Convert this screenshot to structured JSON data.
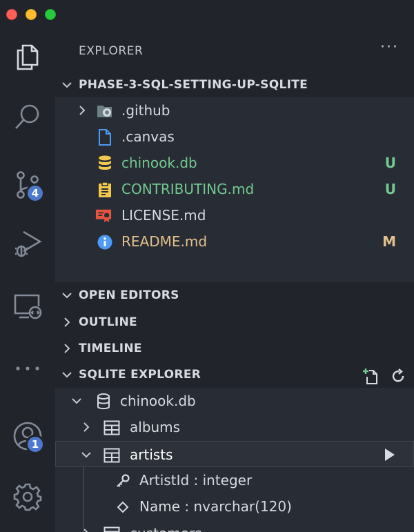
{
  "activity_bar": {
    "scm_badge": "4",
    "accounts_badge": "1",
    "items": [
      "files-icon",
      "search-icon",
      "source-control-icon",
      "run-debug-icon",
      "remote-explorer-icon",
      "more-icon",
      "accounts-icon",
      "gear-icon"
    ]
  },
  "explorer": {
    "title": "EXPLORER",
    "more": "···",
    "project_section": "PHASE-3-SQL-SETTING-UP-SQLITE",
    "files": [
      {
        "name": ".github",
        "icon": "github-folder-icon",
        "status": "",
        "color": "#d7dae0"
      },
      {
        "name": ".canvas",
        "icon": "file-icon",
        "status": "",
        "color": "#d7dae0"
      },
      {
        "name": "chinook.db",
        "icon": "database-icon",
        "status": "U",
        "color": "#73c991"
      },
      {
        "name": "CONTRIBUTING.md",
        "icon": "clipboard-icon",
        "status": "U",
        "color": "#73c991"
      },
      {
        "name": "LICENSE.md",
        "icon": "certificate-icon",
        "status": "",
        "color": "#d7dae0"
      },
      {
        "name": "README.md",
        "icon": "info-icon",
        "status": "M",
        "color": "#e2c08d"
      }
    ]
  },
  "sections": {
    "open_editors": "OPEN EDITORS",
    "outline": "OUTLINE",
    "timeline": "TIMELINE",
    "sqlite_explorer": "SQLITE EXPLORER"
  },
  "sqlite": {
    "database": "chinook.db",
    "tables": [
      "albums",
      "artists",
      "customers"
    ],
    "columns": [
      {
        "label": "ArtistId : integer",
        "icon": "key-icon"
      },
      {
        "label": "Name : nvarchar(120)",
        "icon": "diamond-icon"
      }
    ]
  },
  "colors": {
    "untracked": "#73c991",
    "modified": "#e2c08d",
    "badge": "#4d78cc",
    "accent_blue": "#4d9bf6"
  }
}
